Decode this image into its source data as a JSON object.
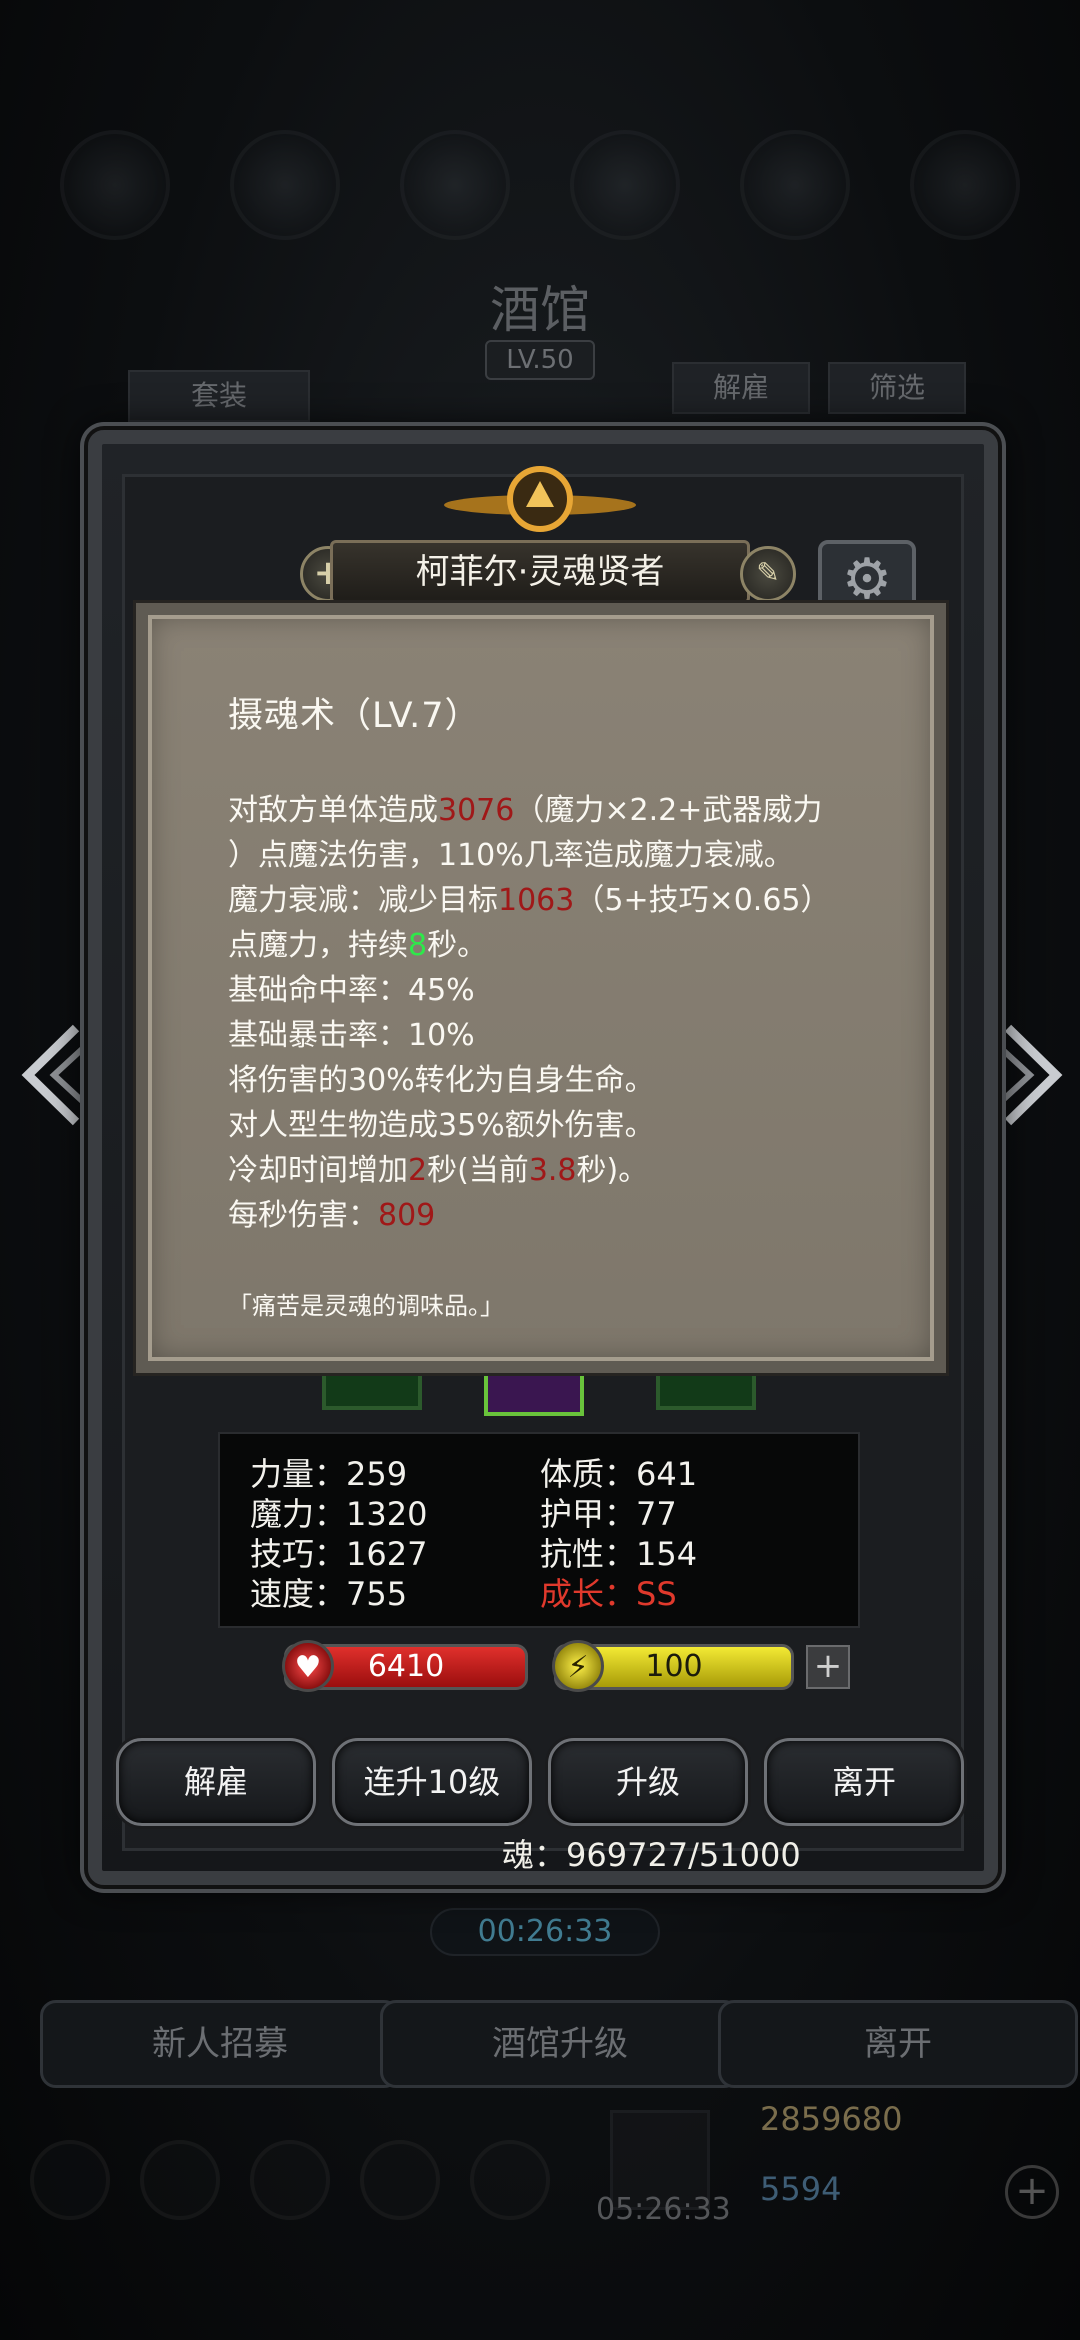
{
  "background": {
    "title": "酒馆",
    "level": "LV.50",
    "buttons": {
      "suits": "套装",
      "dismiss": "解雇",
      "filter": "筛选"
    },
    "timer": "00:26:33",
    "bottom_buttons": {
      "recruit": "新人招募",
      "upgrade_tavern": "酒馆升级",
      "leave": "离开"
    },
    "gold": "2859680",
    "gems": "5594",
    "box_timer": "05:26:33"
  },
  "hero": {
    "name": "柯菲尔·灵魂贤者"
  },
  "tooltip": {
    "title": "摄魂术（LV.7）",
    "line1": {
      "a": "对敌方单体造成",
      "b": "3076",
      "c": "（魔力×2.2+武器威力"
    },
    "line2": "）点魔法伤害，110%几率造成魔力衰减。",
    "line3": {
      "a": "魔力衰减：减少目标",
      "b": "1063",
      "c": "（5+技巧×0.65）"
    },
    "line4": {
      "a": "点魔力，持续",
      "b": "8",
      "c": "秒。"
    },
    "line5": "基础命中率：45%",
    "line6": "基础暴击率：10%",
    "line7": "将伤害的30%转化为自身生命。",
    "line8": "对人型生物造成35%额外伤害。",
    "line9": {
      "a": "冷却时间增加",
      "b": "2",
      "c": "秒(当前",
      "d": "3.8",
      "e": "秒)。"
    },
    "line10": {
      "a": "每秒伤害：",
      "b": "809"
    },
    "quote": "「痛苦是灵魂的调味品。」"
  },
  "stats": {
    "strength": "力量：259",
    "constitution": "体质：641",
    "magic": "魔力：1320",
    "armor": "护甲：77",
    "skill": "技巧：1627",
    "resistance": "抗性：154",
    "speed": "速度：755",
    "growth": "成长：SS"
  },
  "bars": {
    "hp": "6410",
    "energy": "100",
    "plus": "+"
  },
  "actions": {
    "dismiss": "解雇",
    "level10": "连升10级",
    "upgrade": "升级",
    "leave": "离开"
  },
  "soul": "魂：969727/51000",
  "colors": {
    "highlight_red": "#a01818",
    "highlight_green": "#2ee84a",
    "growth_red": "#e0392c"
  }
}
